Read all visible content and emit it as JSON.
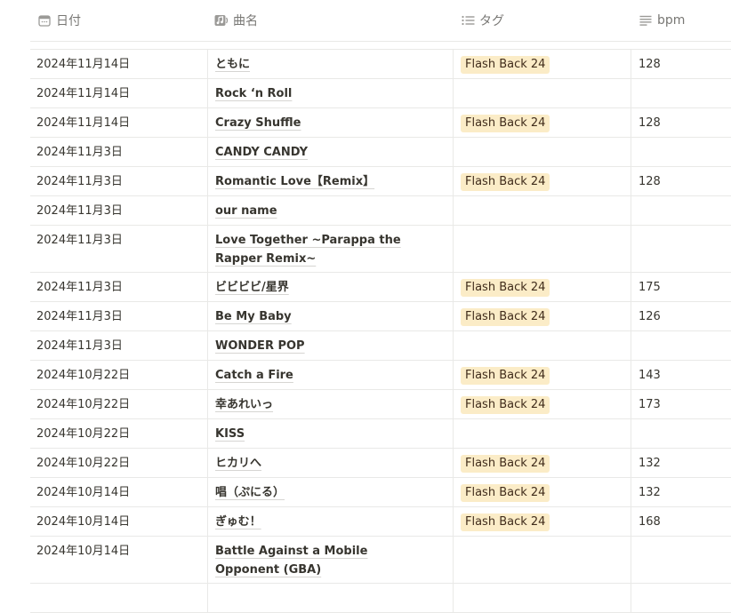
{
  "columns": {
    "date": "日付",
    "title": "曲名",
    "tags": "タグ",
    "bpm": "bpm"
  },
  "icons": {
    "date": "calendar-icon",
    "title": "music-note-icon",
    "tags": "list-icon",
    "bpm": "text-lines-icon"
  },
  "colors": {
    "tag_bg": "#fbecc7",
    "tag_text": "#402c1b",
    "header_text": "#787774",
    "border": "#e9e9e7"
  },
  "rows": [
    {
      "date": "2024年11月14日",
      "title": "ともに",
      "tag": "Flash Back 24",
      "bpm": "128"
    },
    {
      "date": "2024年11月14日",
      "title": "Rock ‘n Roll",
      "tag": "",
      "bpm": ""
    },
    {
      "date": "2024年11月14日",
      "title": "Crazy Shuffle",
      "tag": "Flash Back 24",
      "bpm": "128"
    },
    {
      "date": "2024年11月3日",
      "title": "CANDY CANDY",
      "tag": "",
      "bpm": ""
    },
    {
      "date": "2024年11月3日",
      "title": "Romantic Love【Remix】",
      "tag": "Flash Back 24",
      "bpm": "128"
    },
    {
      "date": "2024年11月3日",
      "title": "our name",
      "tag": "",
      "bpm": ""
    },
    {
      "date": "2024年11月3日",
      "title": "Love Together ~Parappa the Rapper Remix~",
      "tag": "",
      "bpm": "",
      "tall": true
    },
    {
      "date": "2024年11月3日",
      "title": "ビビビビ/星界",
      "tag": "Flash Back 24",
      "bpm": "175"
    },
    {
      "date": "2024年11月3日",
      "title": "Be My Baby",
      "tag": "Flash Back 24",
      "bpm": "126"
    },
    {
      "date": "2024年11月3日",
      "title": "WONDER POP",
      "tag": "",
      "bpm": ""
    },
    {
      "date": "2024年10月22日",
      "title": "Catch a Fire",
      "tag": "Flash Back 24",
      "bpm": "143"
    },
    {
      "date": "2024年10月22日",
      "title": "幸あれいっ",
      "tag": "Flash Back 24",
      "bpm": "173"
    },
    {
      "date": "2024年10月22日",
      "title": "KISS",
      "tag": "",
      "bpm": ""
    },
    {
      "date": "2024年10月22日",
      "title": "ヒカリへ",
      "tag": "Flash Back 24",
      "bpm": "132"
    },
    {
      "date": "2024年10月14日",
      "title": "唱（ぷにる）",
      "tag": "Flash Back 24",
      "bpm": "132"
    },
    {
      "date": "2024年10月14日",
      "title": "ぎゅむ！",
      "tag": "Flash Back 24",
      "bpm": "168"
    },
    {
      "date": "2024年10月14日",
      "title": "Battle Against a Mobile Opponent (GBA)",
      "tag": "",
      "bpm": "",
      "tall": true
    },
    {
      "date": "",
      "title": "",
      "tag": "",
      "bpm": ""
    }
  ]
}
